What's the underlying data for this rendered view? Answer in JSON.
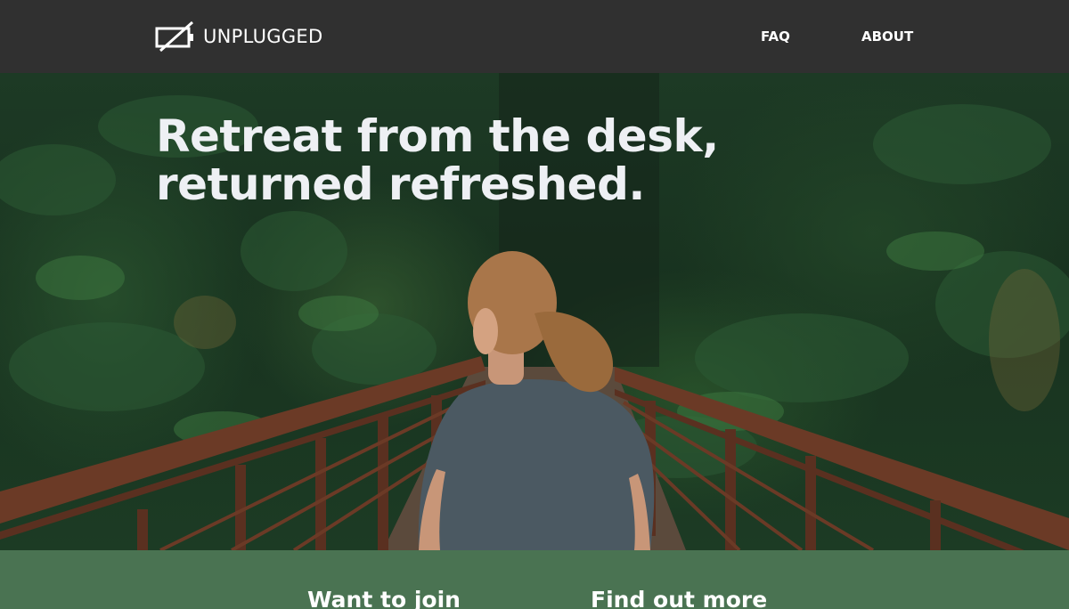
{
  "brand": {
    "name": "UNPLUGGED",
    "logo_icon": "unplugged-battery-icon"
  },
  "nav": {
    "items": [
      {
        "label": "FAQ"
      },
      {
        "label": "ABOUT"
      }
    ]
  },
  "hero": {
    "headline_line1": "Retreat from the desk,",
    "headline_line2": "returned refreshed."
  },
  "cta": {
    "join_heading": "Want to join",
    "more_heading": "Find out more"
  },
  "colors": {
    "navbar_bg": "#303030",
    "cta_band_bg": "#4a7352",
    "text": "#ffffff"
  }
}
